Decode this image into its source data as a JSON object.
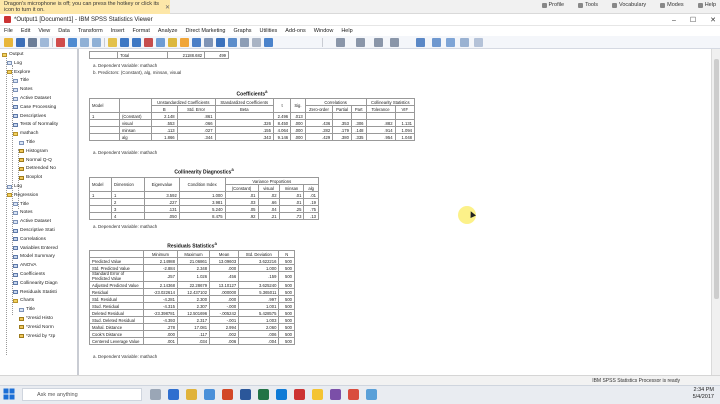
{
  "notice": {
    "text": "Dragon's microphone is off; you can press the hotkey or click its icon to turn it on."
  },
  "browser_links": [
    "Profile",
    "Tools",
    "Vocabulary",
    "Modes",
    "Help"
  ],
  "window": {
    "title": "*Output1 [Document1] - IBM SPSS Statistics Viewer"
  },
  "window_controls": [
    "–",
    "☐",
    "✕"
  ],
  "menu": [
    "File",
    "Edit",
    "View",
    "Data",
    "Transform",
    "Insert",
    "Format",
    "Analyze",
    "Direct Marketing",
    "Graphs",
    "Utilities",
    "Add-ons",
    "Window",
    "Help"
  ],
  "nav": {
    "items": [
      {
        "label": "Output",
        "icon": "book-icon"
      },
      {
        "label": "Log",
        "icon": "doc-icon"
      },
      {
        "label": "Explore",
        "icon": "book-icon"
      },
      {
        "label": "Title",
        "icon": "doc-icon"
      },
      {
        "label": "Notes",
        "icon": "doc-icon"
      },
      {
        "label": "Active Dataset",
        "icon": "doc-icon"
      },
      {
        "label": "Case Processing",
        "icon": "table-icon"
      },
      {
        "label": "Descriptives",
        "icon": "table-icon"
      },
      {
        "label": "Tests of Normality",
        "icon": "table-icon"
      },
      {
        "label": "mathach",
        "icon": "book-icon"
      },
      {
        "label": "Title",
        "icon": "doc-icon"
      },
      {
        "label": "Histogram",
        "icon": "chart-icon"
      },
      {
        "label": "Normal Q-Q",
        "icon": "chart-icon"
      },
      {
        "label": "Detrended No",
        "icon": "chart-icon"
      },
      {
        "label": "Boxplot",
        "icon": "chart-icon"
      },
      {
        "label": "Log",
        "icon": "doc-icon"
      },
      {
        "label": "Regression",
        "icon": "book-icon"
      },
      {
        "label": "Title",
        "icon": "doc-icon"
      },
      {
        "label": "Notes",
        "icon": "doc-icon"
      },
      {
        "label": "Active Dataset",
        "icon": "doc-icon"
      },
      {
        "label": "Descriptive Stati",
        "icon": "table-icon"
      },
      {
        "label": "Correlations",
        "icon": "table-icon"
      },
      {
        "label": "Variables Entered",
        "icon": "table-icon"
      },
      {
        "label": "Model Summary",
        "icon": "table-icon"
      },
      {
        "label": "ANOVA",
        "icon": "table-icon"
      },
      {
        "label": "Coefficients",
        "icon": "table-icon"
      },
      {
        "label": "Collinearity Diagn",
        "icon": "table-icon"
      },
      {
        "label": "Residuals Statisti",
        "icon": "table-icon"
      },
      {
        "label": "Charts",
        "icon": "book-icon"
      },
      {
        "label": "Title",
        "icon": "doc-icon"
      },
      {
        "label": "*zresid Histo",
        "icon": "chart-icon"
      },
      {
        "label": "*zresid Norm",
        "icon": "chart-icon"
      },
      {
        "label": "*zresid by *zp",
        "icon": "chart-icon"
      }
    ]
  },
  "anova_tail": {
    "label": "Total",
    "sum": "21188.682",
    "df": "499"
  },
  "anova_notes": [
    "a. Dependent Variable: mathach",
    "b. Predictors: (Constant), alg, minsan, visual"
  ],
  "coefficients": {
    "title": "Coefficients",
    "title_sup": "a",
    "headers": {
      "model": "Model",
      "unstd": "Unstandardized Coefficients",
      "std": "Standardized Coefficients",
      "t": "t",
      "sig": "Sig.",
      "corr": "Correlations",
      "coll": "Collinearity Statistics",
      "b": "B",
      "se": "Std. Error",
      "beta": "Beta",
      "zero": "Zero-order",
      "partial": "Partial",
      "part": "Part",
      "tol": "Tolerance",
      "vif": "VIF"
    },
    "model_num": "1",
    "rows": [
      [
        "(Constant)",
        "2.148",
        ".861",
        "",
        "2.496",
        ".013",
        "",
        "",
        "",
        "",
        ""
      ],
      [
        "visual",
        ".553",
        ".066",
        ".326",
        "8.450",
        ".000",
        ".436",
        ".353",
        ".306",
        ".882",
        "1.131"
      ],
      [
        "minsan",
        ".113",
        ".027",
        ".155",
        "4.064",
        ".000",
        ".282",
        ".179",
        ".148",
        ".914",
        "1.094"
      ],
      [
        "alg",
        "1.866",
        ".344",
        ".343",
        "9.146",
        ".000",
        ".429",
        ".380",
        ".335",
        ".954",
        "1.048"
      ]
    ],
    "note": "a. Dependent Variable: mathach"
  },
  "collinearity": {
    "title": "Collinearity Diagnostics",
    "title_sup": "a",
    "headers": {
      "model": "Model",
      "dim": "Dimension",
      "eig": "Eigenvalue",
      "cond": "Condition Index",
      "vp": "Variance Proportions",
      "const": "(Constant)",
      "visual": "visual",
      "minsan": "minsan",
      "alg": "alg"
    },
    "model_num": "1",
    "rows": [
      [
        "1",
        "3.592",
        "1.000",
        ".01",
        ".02",
        ".01",
        ".01"
      ],
      [
        "2",
        ".227",
        "3.981",
        ".03",
        ".66",
        ".01",
        ".19"
      ],
      [
        "3",
        ".131",
        "5.240",
        ".05",
        ".04",
        ".25",
        ".75"
      ],
      [
        "4",
        ".050",
        "8.475",
        ".92",
        ".21",
        ".73",
        ".13"
      ]
    ],
    "note": "a. Dependent Variable: mathach"
  },
  "residuals": {
    "title": "Residuals Statistics",
    "title_sup": "a",
    "headers": [
      "",
      "Minimum",
      "Maximum",
      "Mean",
      "Std. Deviation",
      "N"
    ],
    "rows": [
      [
        "Predicted Value",
        "2.14988",
        "21.06861",
        "13.09603",
        "3.622216",
        "500"
      ],
      [
        "Std. Predicted Value",
        "-2.884",
        "2.348",
        ".000",
        "1.000",
        "500"
      ],
      [
        "Standard Error of Predicted Value",
        ".257",
        "1.026",
        ".456",
        ".159",
        "500"
      ],
      [
        "Adjusted Predicted Value",
        "2.14368",
        "22.28679",
        "13.10127",
        "3.625240",
        "500"
      ],
      [
        "Residual",
        "-23.022614",
        "12.437102",
        ".000000",
        "5.365011",
        "500"
      ],
      [
        "Std. Residual",
        "-4.281",
        "2.300",
        ".000",
        ".997",
        "500"
      ],
      [
        "Stud. Residual",
        "-4.315",
        "2.307",
        "-.000",
        "1.001",
        "500"
      ],
      [
        "Deleted Residual",
        "-23.398781",
        "12.501696",
        "-.005242",
        "5.428575",
        "500"
      ],
      [
        "Stud. Deleted Residual",
        "-4.393",
        "2.317",
        "-.001",
        "1.003",
        "500"
      ],
      [
        "Mahal. Distance",
        ".278",
        "17.081",
        "2.994",
        "2.060",
        "500"
      ],
      [
        "Cook's Distance",
        ".000",
        ".117",
        ".002",
        ".006",
        "500"
      ],
      [
        "Centered Leverage Value",
        ".001",
        ".034",
        ".006",
        ".004",
        "500"
      ]
    ],
    "note": "a. Dependent Variable: mathach"
  },
  "status": {
    "text": "IBM SPSS Statistics Processor is ready"
  },
  "taskbar": {
    "search_placeholder": "Ask me anything",
    "time": "2:34 PM",
    "date": "5/4/2017"
  }
}
